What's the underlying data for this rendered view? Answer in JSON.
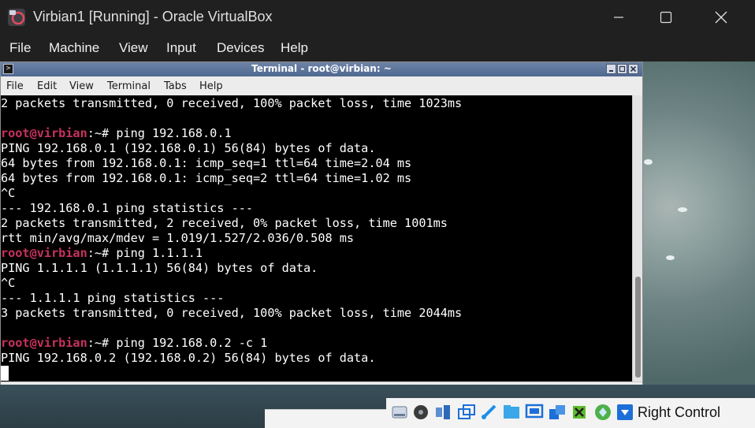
{
  "host": {
    "title": "Virbian1 [Running] - Oracle VirtualBox",
    "menu": [
      "File",
      "Machine",
      "View",
      "Input",
      "Devices",
      "Help"
    ],
    "status_host_key": "Right Control"
  },
  "terminal": {
    "title": "Terminal - root@virbian: ~",
    "menu": [
      "File",
      "Edit",
      "View",
      "Terminal",
      "Tabs",
      "Help"
    ],
    "prompt": "root@virbian",
    "prompt_suffix": ":~# ",
    "lines": [
      "2 packets transmitted, 0 received, 100% packet loss, time 1023ms",
      "",
      {
        "prompt": true,
        "cmd": "ping 192.168.0.1"
      },
      "PING 192.168.0.1 (192.168.0.1) 56(84) bytes of data.",
      "64 bytes from 192.168.0.1: icmp_seq=1 ttl=64 time=2.04 ms",
      "64 bytes from 192.168.0.1: icmp_seq=2 ttl=64 time=1.02 ms",
      "^C",
      "--- 192.168.0.1 ping statistics ---",
      "2 packets transmitted, 2 received, 0% packet loss, time 1001ms",
      "rtt min/avg/max/mdev = 1.019/1.527/2.036/0.508 ms",
      {
        "prompt": true,
        "cmd": "ping 1.1.1.1"
      },
      "PING 1.1.1.1 (1.1.1.1) 56(84) bytes of data.",
      "^C",
      "--- 1.1.1.1 ping statistics ---",
      "3 packets transmitted, 0 received, 100% packet loss, time 2044ms",
      "",
      {
        "prompt": true,
        "cmd": "ping 192.168.0.2 -c 1"
      },
      "PING 192.168.0.2 (192.168.0.2) 56(84) bytes of data."
    ]
  },
  "colors": {
    "prompt": "#c8325e",
    "terminal_bg": "#000000",
    "terminal_fg": "#ffffff",
    "host_titlebar": "#202020",
    "xfce_titlebar": "#5a7199"
  },
  "icons": {
    "app": "virtualbox-icon",
    "status": [
      "storage-icon",
      "optical-disk-icon",
      "audio-icon",
      "network-icon",
      "usb-icon",
      "shared-folders-icon",
      "display-icon",
      "video-capture-icon",
      "cpu-icon",
      "mouse-integration-icon",
      "keyboard-capture-icon"
    ]
  }
}
